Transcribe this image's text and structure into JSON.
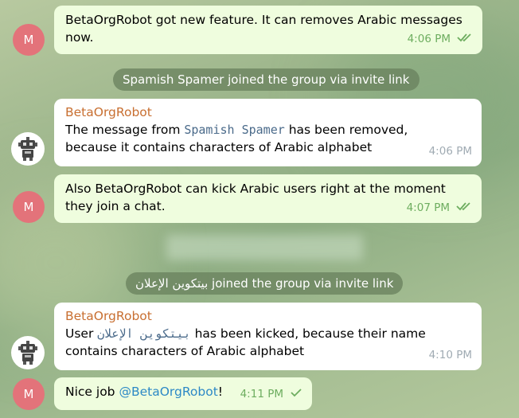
{
  "messages": [
    {
      "avatar_letter": "M",
      "text": "BetaOrgRobot got new feature. It can removes Arabic messages now.",
      "time": "4:06 PM"
    },
    {
      "service": "Spamish Spamer joined the group via invite link"
    },
    {
      "sender": "BetaOrgRobot",
      "text_before": "The message from ",
      "mono_name": "Spamish Spamer",
      "text_after": " has been removed, because it contains characters of Arabic alphabet",
      "time": "4:06 PM"
    },
    {
      "avatar_letter": "M",
      "text": "Also BetaOrgRobot can kick Arabic users right at the moment they join a chat.",
      "time": "4:07 PM"
    },
    {
      "service_arabic_name": "بيتكوين الإعلان",
      "service_rest": " joined the group via invite link"
    },
    {
      "sender": "BetaOrgRobot",
      "text_before": "User ",
      "mono_name": "بيتكوين الإعلان",
      "text_after": " has been kicked, because their name contains characters of Arabic alphabet",
      "time": "4:10 PM"
    },
    {
      "avatar_letter": "M",
      "text_before": "Nice job ",
      "mention": "@BetaOrgRobot",
      "text_after": "!",
      "time": "4:11 PM"
    }
  ],
  "icons": {
    "read_receipt": "double-check-icon",
    "sent_receipt": "single-check-icon",
    "bot_avatar": "robot-icon"
  },
  "colors": {
    "outgoing_bubble": "#effdde",
    "incoming_bubble": "#ffffff",
    "sender_name": "#c86f31",
    "avatar": "#e3737a",
    "time_outgoing": "#6dad5f"
  }
}
